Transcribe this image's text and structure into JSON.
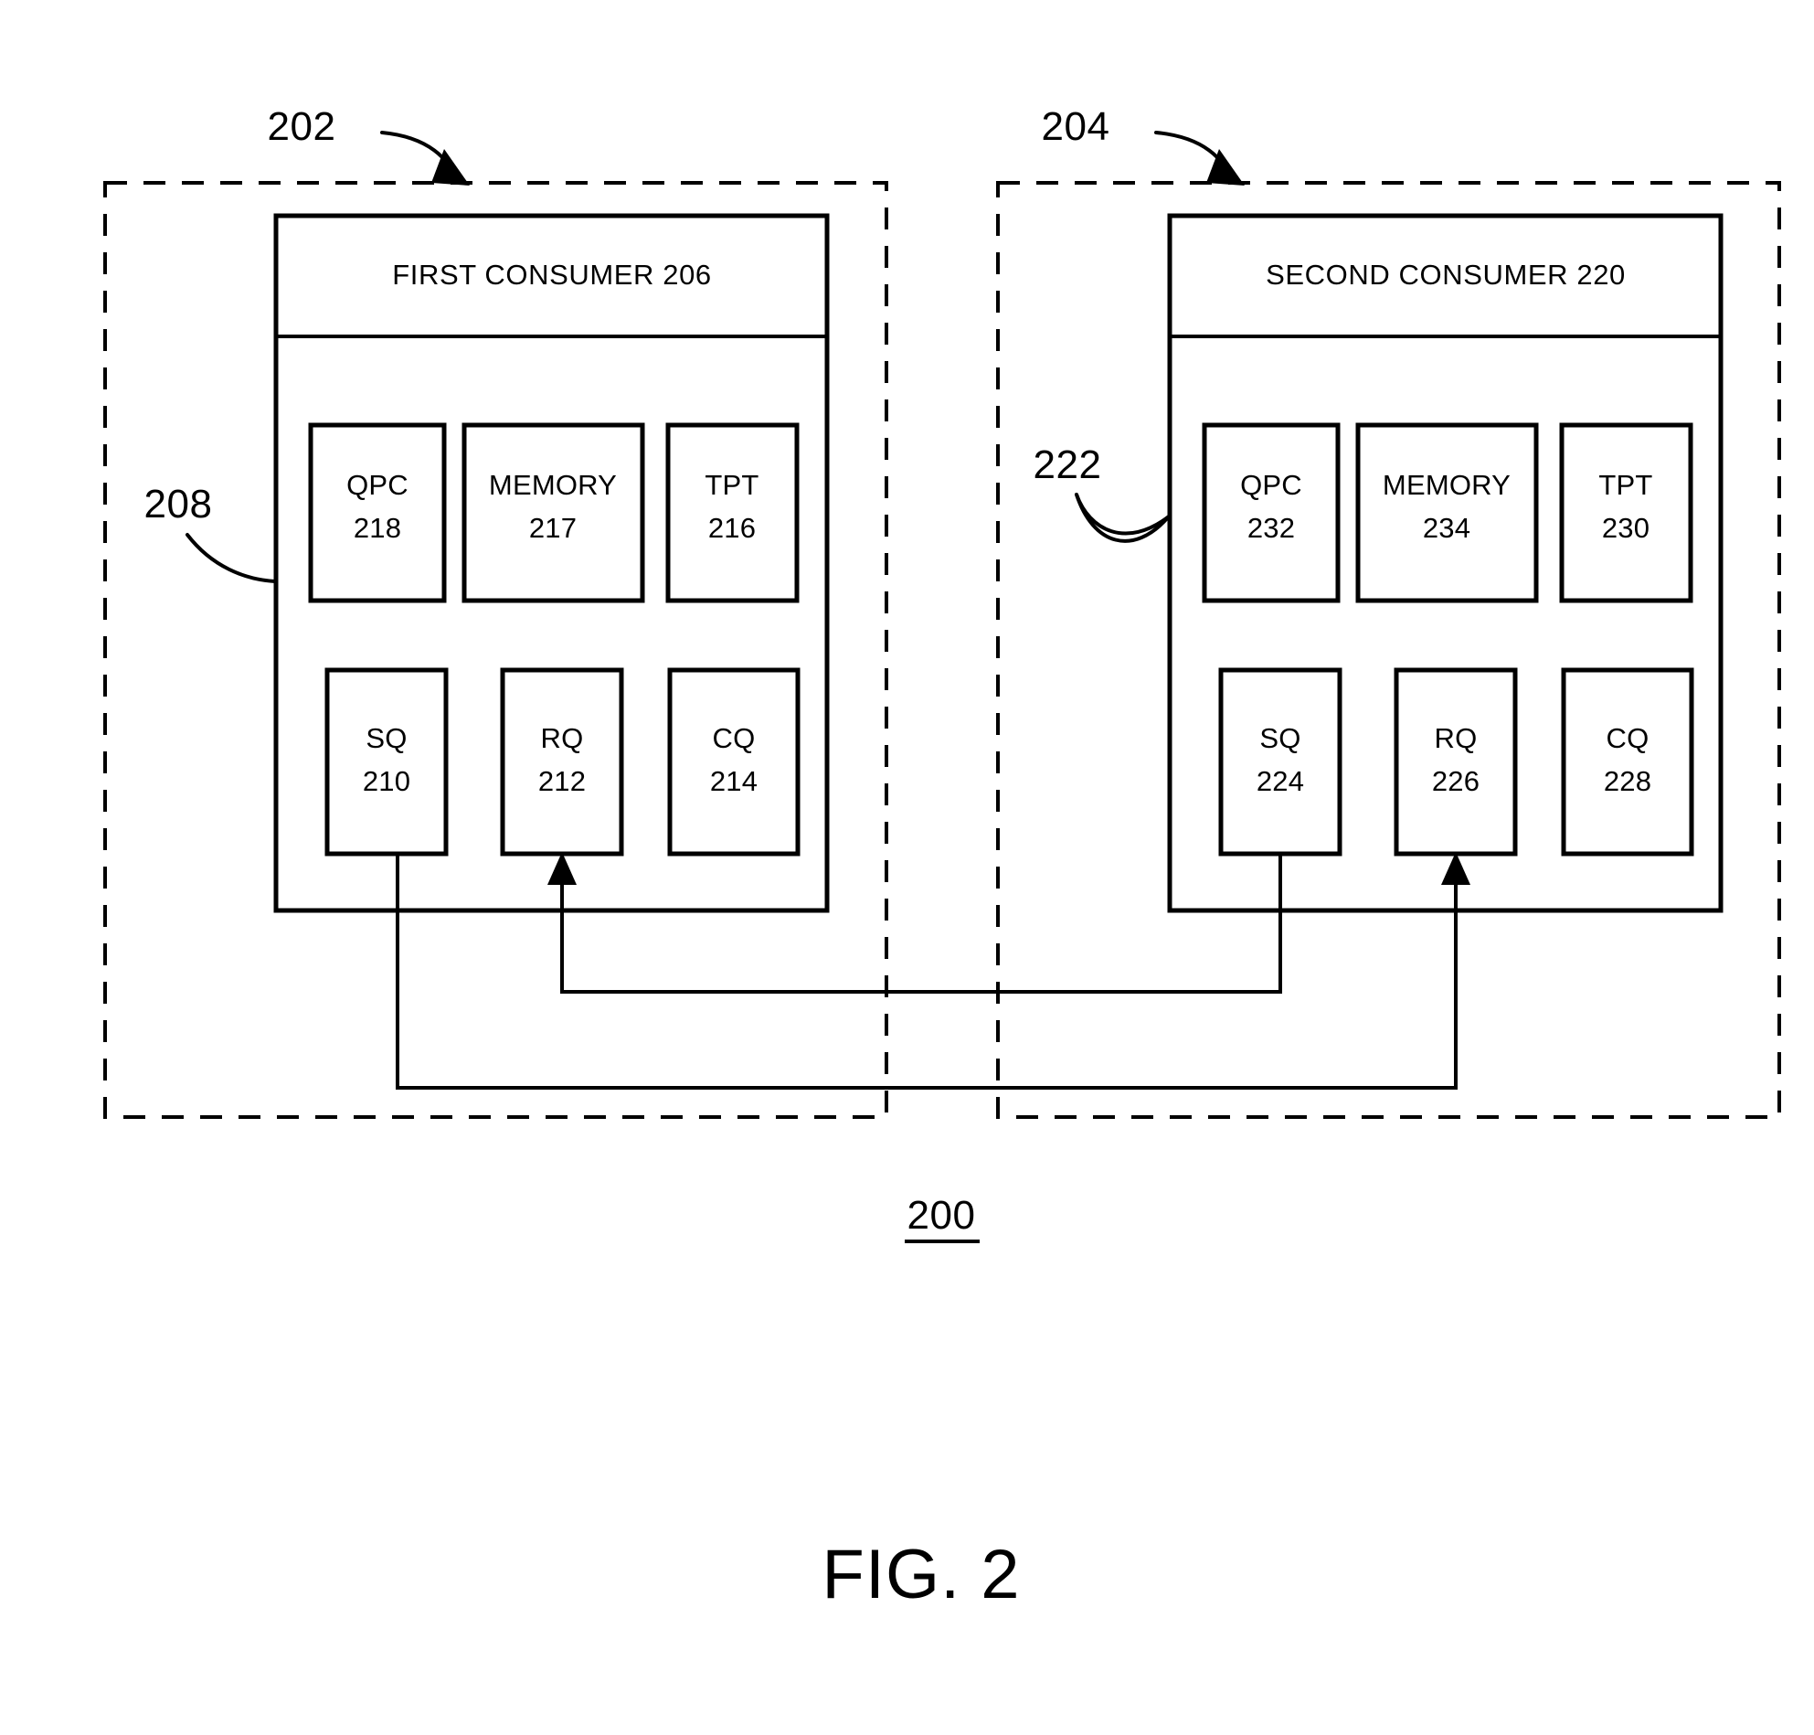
{
  "figure": {
    "caption": "FIG. 2",
    "system_number": "200"
  },
  "nodes": [
    {
      "ref": "202",
      "panel_title": "FIRST CONSUMER 206",
      "inner_ref": "208",
      "top_row": [
        {
          "name": "QPC",
          "number": "218"
        },
        {
          "name": "MEMORY",
          "number": "217"
        },
        {
          "name": "TPT",
          "number": "216"
        }
      ],
      "bottom_row": [
        {
          "name": "SQ",
          "number": "210"
        },
        {
          "name": "RQ",
          "number": "212"
        },
        {
          "name": "CQ",
          "number": "214"
        }
      ]
    },
    {
      "ref": "204",
      "panel_title": "SECOND CONSUMER 220",
      "inner_ref": "222",
      "top_row": [
        {
          "name": "QPC",
          "number": "232"
        },
        {
          "name": "MEMORY",
          "number": "234"
        },
        {
          "name": "TPT",
          "number": "230"
        }
      ],
      "bottom_row": [
        {
          "name": "SQ",
          "number": "224"
        },
        {
          "name": "RQ",
          "number": "226"
        },
        {
          "name": "CQ",
          "number": "228"
        }
      ]
    }
  ],
  "colors": {
    "ink": "#000000",
    "paper": "#ffffff"
  }
}
